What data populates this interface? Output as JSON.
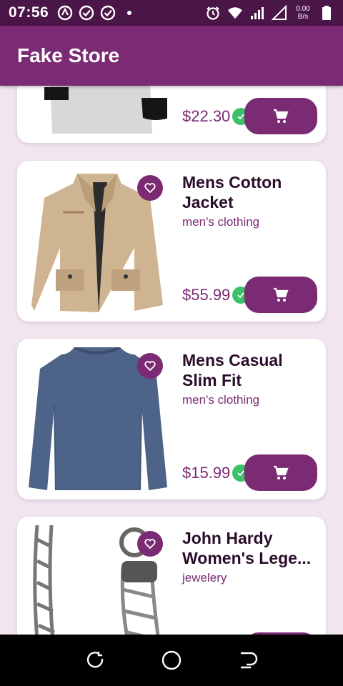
{
  "status_bar": {
    "time": "07:56",
    "net_speed_value": "0.00",
    "net_speed_unit": "B/s",
    "icons_left": [
      "vpn-icon",
      "check-circle-icon",
      "check-circle-icon",
      "dot-icon"
    ],
    "icons_right": [
      "alarm-icon",
      "wifi-icon",
      "signal-icon",
      "signal-empty-icon",
      "battery-icon"
    ]
  },
  "app_bar": {
    "title": "Fake Store"
  },
  "colors": {
    "primary": "#7b2b74",
    "status_bar": "#4a1547",
    "background": "#f1e6f0",
    "check": "#3cc06a"
  },
  "products": [
    {
      "title_line1": "",
      "title_line2": "",
      "category": "",
      "price": "$22.30",
      "image": "tshirt-image"
    },
    {
      "title_line1": "Mens Cotton",
      "title_line2": "Jacket",
      "category": "men's clothing",
      "price": "$55.99",
      "image": "jacket-image"
    },
    {
      "title_line1": "Mens Casual",
      "title_line2": "Slim Fit",
      "category": "men's clothing",
      "price": "$15.99",
      "image": "longsleeve-image"
    },
    {
      "title_line1": "John Hardy",
      "title_line2": "Women's Lege...",
      "category": "jewelery",
      "price": "",
      "image": "bracelet-image"
    }
  ],
  "nav": [
    "back-icon",
    "home-icon",
    "recents-icon"
  ]
}
